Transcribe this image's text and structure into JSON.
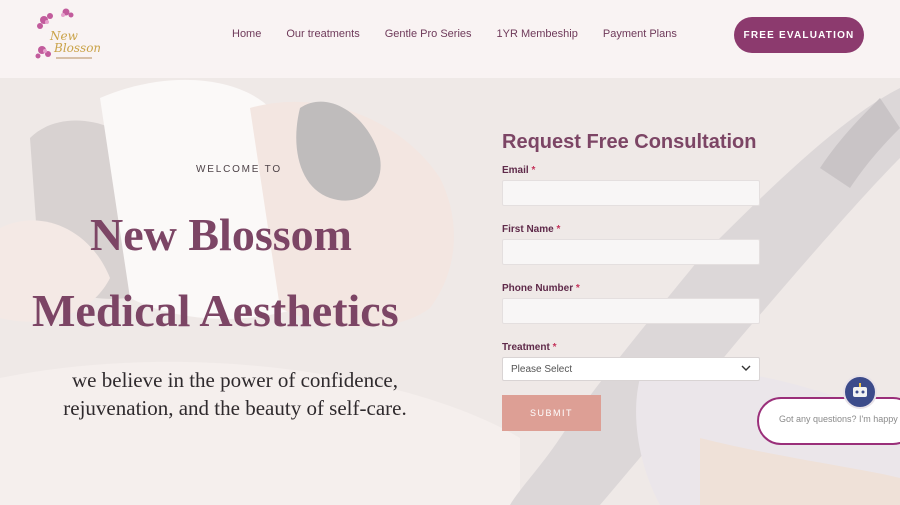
{
  "header": {
    "logo_text": "New Blossom Medical Aesthetics",
    "nav": [
      "Home",
      "Our treatments",
      "Gentle Pro Series",
      "1YR Membeship",
      "Payment Plans"
    ],
    "cta_label": "FREE EVALUATION"
  },
  "hero": {
    "welcome": "WELCOME TO",
    "title_line1": "New Blossom",
    "title_line2": "Medical Aesthetics",
    "tagline": "we believe in the power of confidence, rejuvenation, and the beauty of self-care."
  },
  "form": {
    "title": "Request Free Consultation",
    "required_mark": "*",
    "email_label": "Email",
    "email_value": "",
    "first_name_label": "First Name",
    "first_name_value": "",
    "phone_label": "Phone Number",
    "phone_value": "",
    "treatment_label": "Treatment",
    "treatment_selected": "Please Select",
    "submit_label": "SUBMIT"
  },
  "chat": {
    "placeholder": "Got any questions? I'm happy to help."
  },
  "colors": {
    "brand_plum": "#7c4565",
    "cta_bg": "#8c3a6e",
    "submit_bg": "#dd9f95",
    "chat_border": "#9a2f7a"
  },
  "icons": {
    "select_arrow": "chevron-down-icon",
    "chat_avatar": "chat-bot-icon",
    "logo": "blossom-logo-icon"
  }
}
